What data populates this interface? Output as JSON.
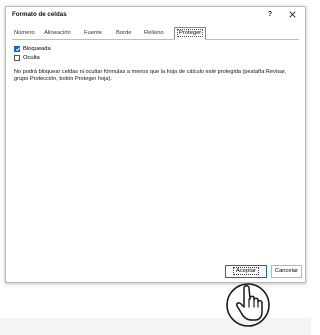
{
  "dialog": {
    "title": "Formato de celdas",
    "help_label": "?",
    "tabs": [
      {
        "label": "Número"
      },
      {
        "label": "Alineación"
      },
      {
        "label": "Fuente"
      },
      {
        "label": "Borde"
      },
      {
        "label": "Relleno"
      },
      {
        "label": "Proteger"
      }
    ],
    "active_tab": "Proteger",
    "options": {
      "locked": {
        "label": "Bloqueada",
        "checked": true
      },
      "hidden": {
        "label": "Oculta",
        "checked": false
      }
    },
    "description": "No podrá bloquear celdas ni ocultar fórmulas a menos que la hoja de cálculo esté protegida (pestaña Revisar, grupo Protección, botón Proteger hoja).",
    "buttons": {
      "accept": "Aceptar",
      "cancel": "Cancelar"
    }
  },
  "colors": {
    "accent": "#1f63c9",
    "border": "#b8b8b8"
  },
  "icons": {
    "close": "close-icon",
    "cursor": "hand-pointer-icon"
  }
}
